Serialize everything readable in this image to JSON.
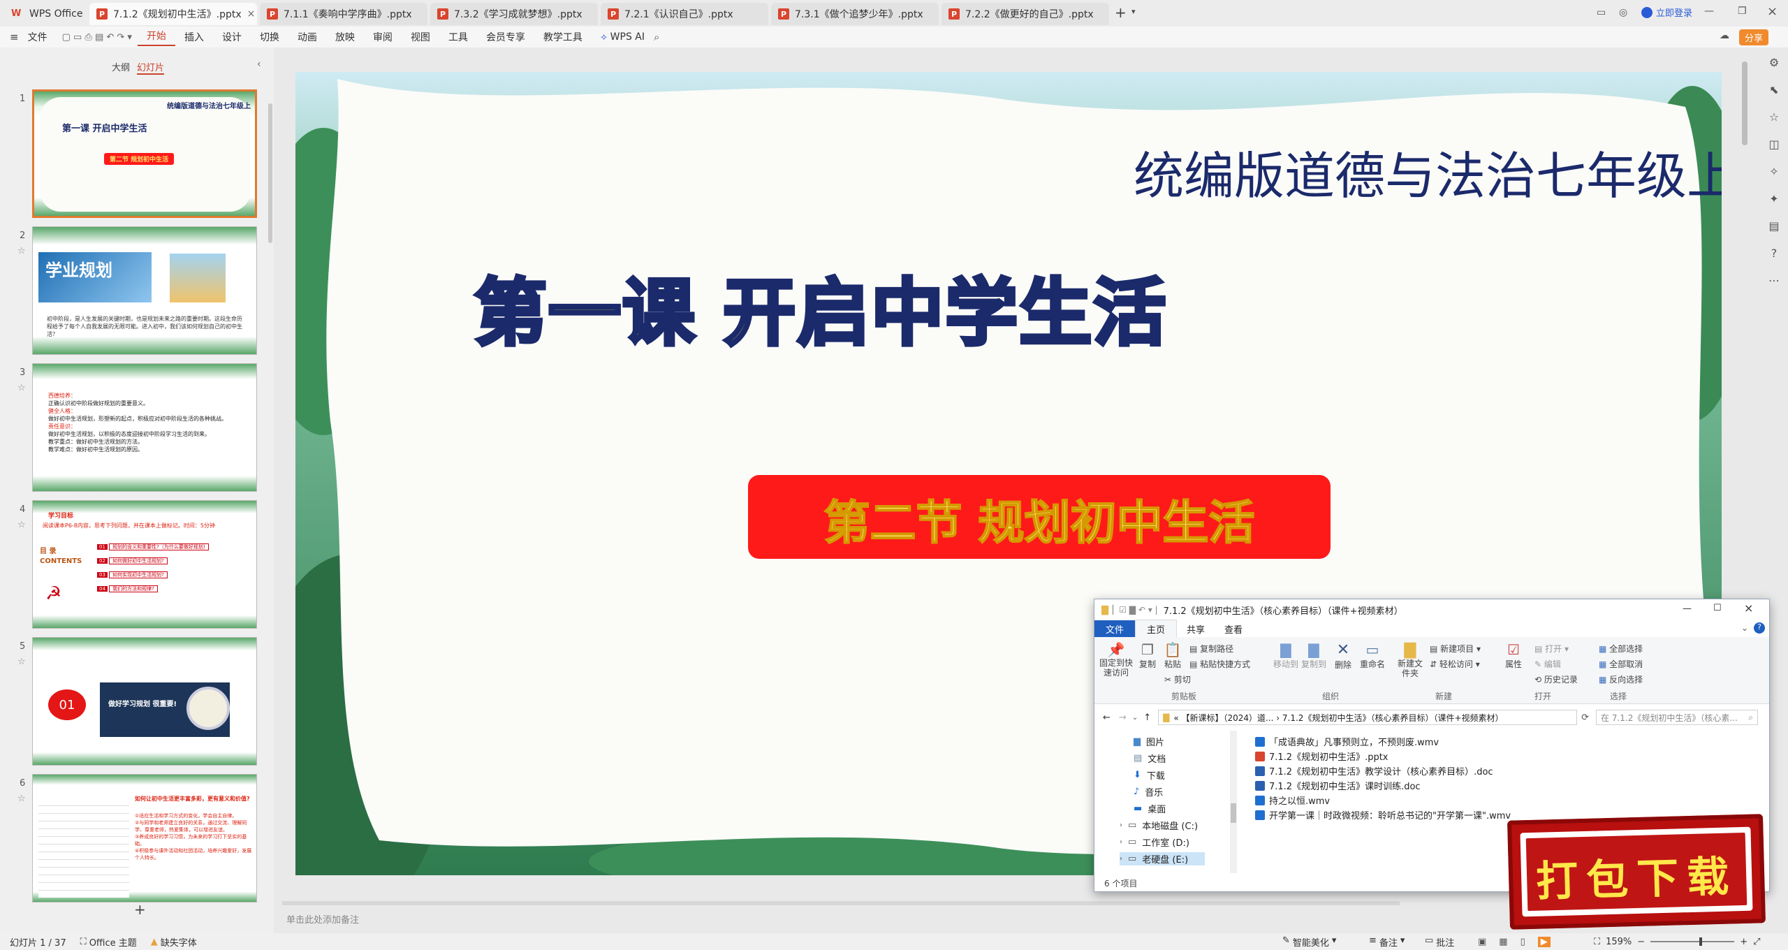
{
  "tabs": [
    {
      "label": "WPS Office"
    },
    {
      "label": "7.1.2《规划初中生活》.pptx"
    },
    {
      "label": "7.1.1《奏响中学序曲》.pptx"
    },
    {
      "label": "7.3.2《学习成就梦想》.pptx"
    },
    {
      "label": "7.2.1《认识自己》.pptx"
    },
    {
      "label": "7.3.1《做个追梦少年》.pptx"
    },
    {
      "label": "7.2.2《做更好的自己》.pptx"
    }
  ],
  "title_right": {
    "login": "立即登录",
    "share": "分享"
  },
  "menu": {
    "file": "文件",
    "items": [
      "开始",
      "插入",
      "设计",
      "切换",
      "动画",
      "放映",
      "审阅",
      "视图",
      "工具",
      "会员专享",
      "教学工具"
    ],
    "wpsai": "WPS AI"
  },
  "panel": {
    "outline": "大纲",
    "slides": "幻灯片",
    "add": "+"
  },
  "thumbs": [
    {
      "num": "1",
      "t1": "统编版道德与法治七年级上",
      "t2": "第一课 开启中学生活",
      "t3": "第二节 规划初中生活"
    },
    {
      "num": "2",
      "t1": "学业规划",
      "t2": "初中阶段，是人生发展的关键时期，也是规划未来之路的重要时期。这段生命历程给予了每个人自我发展的无限可能。进入初中，我们该如何规划自己的初中生活？"
    },
    {
      "num": "3",
      "lines": [
        "西德培养：",
        "正确认识初中阶段做好规划的重要意义。",
        "健全人格：",
        "做好初中生活规划，形塑新的起点，积极应对初中阶段生活的各种挑战。",
        "责任意识：",
        "做好初中生活规划，以积极的态度迎接初中阶段学习生活的到来。",
        "教学重点：做好初中生活规划的方法。",
        "教学难点：做好初中生活规划的原因。"
      ]
    },
    {
      "num": "4",
      "title": "学习目标",
      "sub": "阅读课本P6-8内容，思考下列问题，并在课本上做标记。时间：5分钟",
      "contents": "目 录 CONTENTS",
      "items": [
        "规划的含义和重要性?（为什么要做好规划)",
        "如何做好初中生活规划?",
        "如何实现初中生活规划?",
        "我们的方法和规律?"
      ]
    },
    {
      "num": "5",
      "circle": "01",
      "text": "做好学习规划 很重要!"
    },
    {
      "num": "6",
      "title": "如何让初中生活更丰富多彩，更有意义和价值?",
      "lines": [
        "①适应生活和学习方式的变化，学会自主自律。",
        "②与同学和老师建立良好的关系，通过交流、理解同学、尊重老师，热爱集体，可以增进友谊。",
        "③养成良好的学习习惯，为未来的学习打下坚实的基础。",
        "④积极参与课外活动和社团活动，培养兴趣爱好，发展个人特长。"
      ]
    }
  ],
  "slide": {
    "top_title": "统编版道德与法治七年级上",
    "lesson_title": "第一课 开启中学生活",
    "section_title": "第二节  规划初中生活"
  },
  "notes_placeholder": "单击此处添加备注",
  "explorer": {
    "title": "7.1.2《规划初中生活》（核心素养目标）（课件+视频素材）",
    "ribbon_tabs": [
      "文件",
      "主页",
      "共享",
      "查看"
    ],
    "buttons": {
      "pin": "固定到快速访问",
      "copy": "复制",
      "paste": "粘贴",
      "copy_path": "复制路径",
      "paste_shortcut": "粘贴快捷方式",
      "cut": "剪切",
      "move_to": "移动到",
      "copy_to": "复制到",
      "delete": "删除",
      "rename": "重命名",
      "new_folder": "新建文件夹",
      "new_item": "新建项目",
      "easy_access": "轻松访问",
      "properties": "属性",
      "open": "打开",
      "edit": "编辑",
      "history": "历史记录",
      "select_all": "全部选择",
      "select_none": "全部取消",
      "invert": "反向选择"
    },
    "groups": [
      "剪贴板",
      "组织",
      "新建",
      "打开",
      "选择"
    ],
    "address": "« 【新课标】（2024）道... › 7.1.2《规划初中生活》（核心素养目标）（课件+视频素材）",
    "search_placeholder": "在 7.1.2《规划初中生活》（核心素...",
    "nav": [
      "图片",
      "文档",
      "下载",
      "音乐",
      "桌面",
      "本地磁盘 (C:)",
      "工作室 (D:)",
      "老硬盘 (E:)"
    ],
    "files": [
      "「成语典故」凡事预则立，不预则废.wmv",
      "7.1.2《规划初中生活》.pptx",
      "7.1.2《规划初中生活》教学设计（核心素养目标）.doc",
      "7.1.2《规划初中生活》课时训练.doc",
      "持之以恒.wmv",
      "开学第一课｜时政微视频：聆听总书记的\"开学第一课\".wmv"
    ],
    "count": "6 个项目"
  },
  "download_badge": "打包下载",
  "status": {
    "slide": "幻灯片 1 / 37",
    "theme": "Office 主题",
    "font": "缺失字体",
    "beautify": "智能美化",
    "notes": "备注",
    "comment": "批注",
    "zoom": "159%"
  },
  "colors": {
    "accent": "#c9432c",
    "title_blue": "#1b2a6b",
    "banner_red": "#ff1a1a",
    "banner_text": "#ffe066",
    "lesson_fill": "#f4e04d"
  }
}
